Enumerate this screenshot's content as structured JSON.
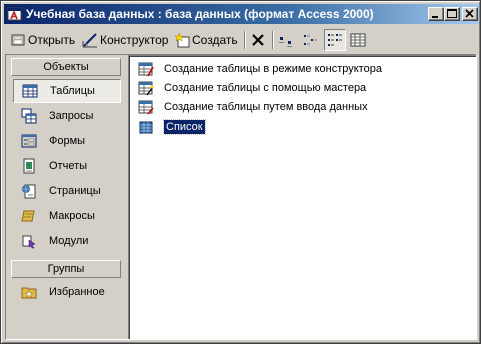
{
  "window": {
    "title": "Учебная база данных : база данных (формат Access 2000)",
    "controls": [
      "minimize",
      "maximize",
      "close"
    ]
  },
  "toolbar": {
    "open_label": "Открыть",
    "design_label": "Конструктор",
    "create_label": "Создать",
    "icons": [
      "delete-icon",
      "large-icons-view-icon",
      "small-icons-view-icon",
      "list-view-icon",
      "details-view-icon"
    ]
  },
  "sidebar": {
    "objects_header": "Объекты",
    "items": [
      {
        "label": "Таблицы",
        "icon": "table-icon"
      },
      {
        "label": "Запросы",
        "icon": "query-icon"
      },
      {
        "label": "Формы",
        "icon": "form-icon"
      },
      {
        "label": "Отчеты",
        "icon": "report-icon"
      },
      {
        "label": "Страницы",
        "icon": "page-icon"
      },
      {
        "label": "Макросы",
        "icon": "macro-icon"
      },
      {
        "label": "Модули",
        "icon": "module-icon"
      }
    ],
    "groups_header": "Группы",
    "groups": [
      {
        "label": "Избранное",
        "icon": "favorites-icon"
      }
    ],
    "selected": "Таблицы"
  },
  "list": {
    "items": [
      {
        "label": "Создание таблицы в режиме конструктора",
        "icon": "design-wizard-icon"
      },
      {
        "label": "Создание таблицы с помощью мастера",
        "icon": "wizard-icon"
      },
      {
        "label": "Создание таблицы путем ввода данных",
        "icon": "data-entry-icon"
      },
      {
        "label": "Список",
        "icon": "table-icon"
      }
    ],
    "selected": "Список"
  },
  "colors": {
    "titlebar_start": "#0a246a",
    "titlebar_end": "#a6caf0",
    "face": "#d4d0c8",
    "selection": "#0a246a"
  }
}
